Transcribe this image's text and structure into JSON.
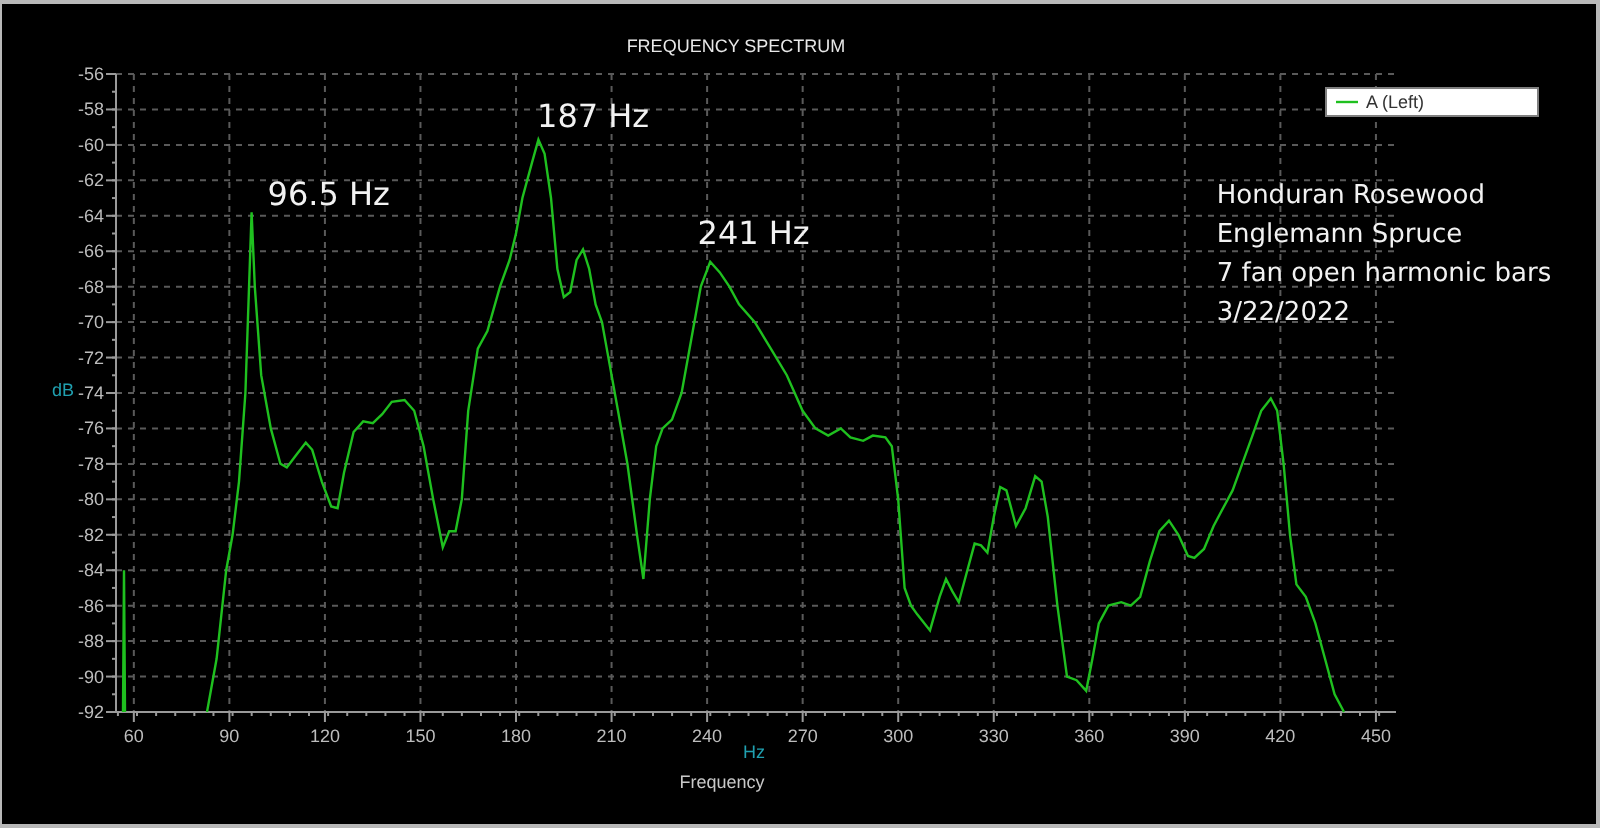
{
  "chart_data": {
    "type": "line",
    "title": "FREQUENCY SPECTRUM",
    "xlabel": "Frequency",
    "ylabel": "dB",
    "grid": true,
    "x": [
      56.6,
      56.9,
      57.2,
      null,
      83,
      86,
      89,
      91,
      93,
      95,
      97,
      98,
      100,
      103,
      106,
      108,
      111,
      114,
      116,
      119,
      122,
      124,
      126,
      129,
      132,
      135,
      138,
      141,
      145,
      148,
      151,
      154,
      157,
      159,
      161,
      163,
      165,
      168,
      171,
      175,
      178,
      180,
      182,
      185,
      187,
      189,
      191,
      193,
      195,
      197,
      199,
      201,
      203,
      205,
      207,
      209,
      212,
      215,
      218,
      220,
      222,
      224,
      226,
      229,
      232,
      235,
      238,
      241,
      244,
      247,
      250,
      255,
      260,
      265,
      270,
      274,
      278,
      282,
      285,
      289,
      292,
      296,
      298,
      300,
      302,
      304,
      306,
      310,
      313,
      315,
      317,
      319,
      321,
      324,
      326,
      328,
      330,
      332,
      334,
      337,
      340,
      343,
      345,
      347,
      350,
      353,
      356,
      359,
      361,
      363,
      366,
      370,
      373,
      376,
      379,
      382,
      385,
      388,
      391,
      393,
      396,
      399,
      402,
      405,
      408,
      411,
      414,
      417,
      419,
      421,
      423,
      425,
      428,
      431,
      434,
      437,
      440
    ],
    "series": [
      {
        "name": "A (Left)",
        "color": "#1fc01f",
        "values": [
          -92,
          -84,
          -92,
          null,
          -92,
          -89,
          -84,
          -82,
          -79,
          -74,
          -63.8,
          -68,
          -73,
          -76,
          -78,
          -78.2,
          -77.5,
          -76.8,
          -77.2,
          -79,
          -80.4,
          -80.5,
          -78.5,
          -76.2,
          -75.6,
          -75.7,
          -75.2,
          -74.5,
          -74.4,
          -75,
          -77,
          -80,
          -82.7,
          -81.8,
          -81.8,
          -80,
          -75,
          -71.5,
          -70.5,
          -68,
          -66.5,
          -65,
          -63,
          -61,
          -59.7,
          -60.5,
          -63,
          -67,
          -68.6,
          -68.3,
          -66.5,
          -65.9,
          -67,
          -69,
          -70,
          -72,
          -75,
          -78,
          -82,
          -84.5,
          -80,
          -77,
          -76,
          -75.5,
          -74,
          -71,
          -68,
          -66.6,
          -67.2,
          -68,
          -69,
          -70,
          -71.5,
          -73,
          -75,
          -76,
          -76.4,
          -76,
          -76.5,
          -76.7,
          -76.4,
          -76.5,
          -77,
          -80,
          -85,
          -86,
          -86.5,
          -87.4,
          -85.5,
          -84.5,
          -85.2,
          -85.8,
          -84.5,
          -82.5,
          -82.6,
          -83,
          -81,
          -79.3,
          -79.5,
          -81.5,
          -80.5,
          -78.7,
          -79,
          -81,
          -86,
          -90,
          -90.2,
          -90.8,
          -89,
          -87,
          -86,
          -85.8,
          -86,
          -85.5,
          -83.5,
          -81.8,
          -81.2,
          -82,
          -83.2,
          -83.3,
          -82.8,
          -81.5,
          -80.5,
          -79.5,
          -78,
          -76.5,
          -75,
          -74.3,
          -75,
          -78,
          -82,
          -84.8,
          -85.5,
          -87,
          -89,
          -91,
          -92
        ]
      }
    ],
    "xlim": [
      54.4,
      456.3
    ],
    "ylim": [
      -92,
      -56
    ],
    "xticks": [
      60,
      90,
      120,
      150,
      180,
      210,
      240,
      270,
      300,
      330,
      360,
      390,
      420,
      450
    ],
    "yticks": [
      -56,
      -58,
      -60,
      -62,
      -64,
      -66,
      -68,
      -70,
      -72,
      -74,
      -76,
      -78,
      -80,
      -82,
      -84,
      -86,
      -88,
      -90,
      -92
    ],
    "annotations": [
      "96.5 Hz",
      "187 Hz",
      "241 Hz",
      "Honduran Rosewood",
      "Englemann Spruce",
      "7 fan open harmonic bars",
      "3/22/2022"
    ]
  },
  "x_axis_unit": "Hz"
}
